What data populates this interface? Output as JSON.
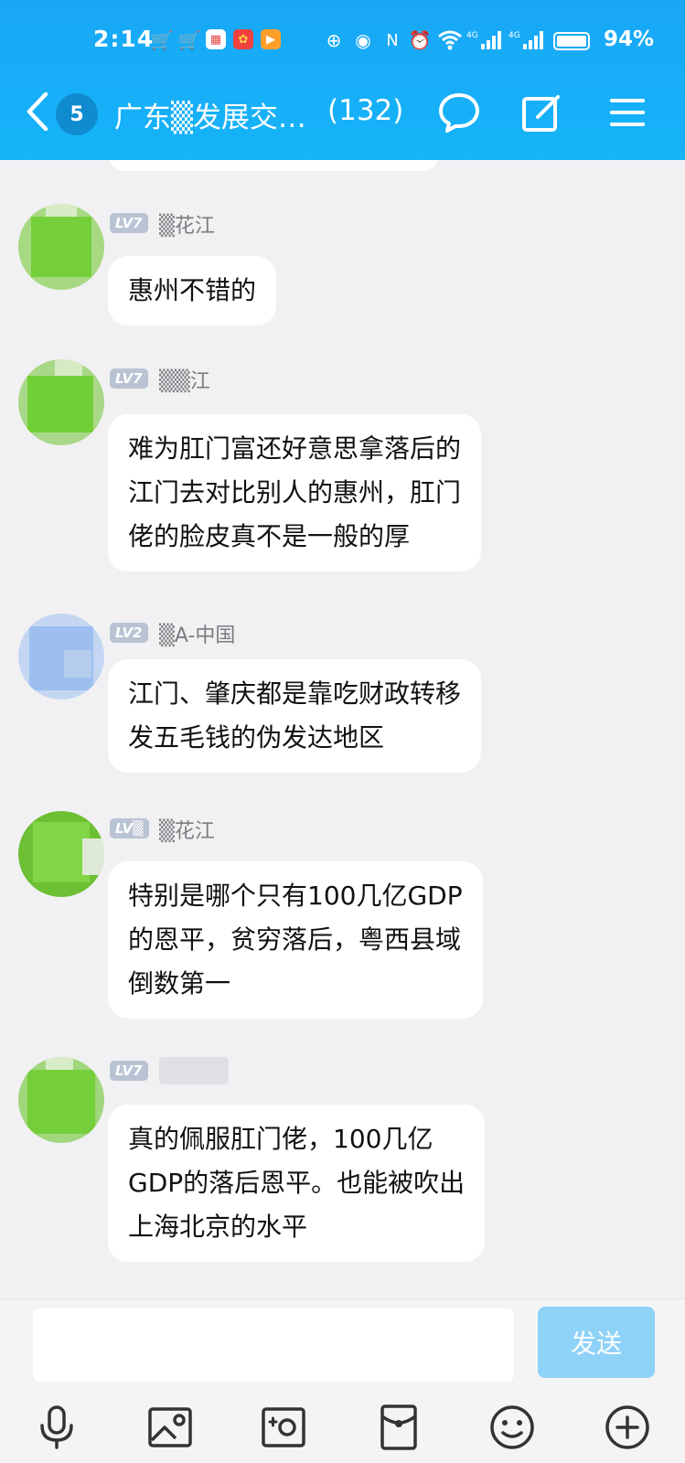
{
  "status_bar": {
    "time": "2:14",
    "battery": "94%",
    "network_labels": [
      "4G",
      "4G"
    ]
  },
  "header": {
    "unread_badge": "5",
    "group_title": "广东▒发展交…",
    "member_count": "(132)"
  },
  "messages": [
    {
      "level": "LV7",
      "nickname": "▒花江",
      "lines": [
        "惠州不错的"
      ]
    },
    {
      "level": "LV7",
      "nickname": "▒▒江",
      "lines": [
        "难为肛门富还好意思拿落后的",
        "江门去对比别人的惠州，肛门",
        "佬的脸皮真不是一般的厚"
      ]
    },
    {
      "level": "LV2",
      "nickname": "▒A-中国",
      "lines": [
        "江门、肇庆都是靠吃财政转移",
        "发五毛钱的伪发达地区"
      ]
    },
    {
      "level": "LV▒",
      "nickname": "▒花江",
      "lines": [
        "特别是哪个只有100几亿GDP",
        "的恩平，贫穷落后，粤西县域",
        "倒数第一"
      ]
    },
    {
      "level": "LV7",
      "nickname": "",
      "lines": [
        "真的佩服肛门佬，100几亿",
        "GDP的落后恩平。也能被吹出",
        "上海北京的水平"
      ]
    }
  ],
  "input": {
    "placeholder": "",
    "send_label": "发送"
  },
  "toolbar": {
    "items": [
      "mic-icon",
      "image-icon",
      "camera-icon",
      "red-packet-icon",
      "emoji-icon",
      "plus-icon"
    ]
  },
  "colors": {
    "header_blue": "#16aef7",
    "send_disabled": "#8fd2f8",
    "avatar_green": "#7fd24a",
    "avatar_blue": "#9dbff0"
  }
}
